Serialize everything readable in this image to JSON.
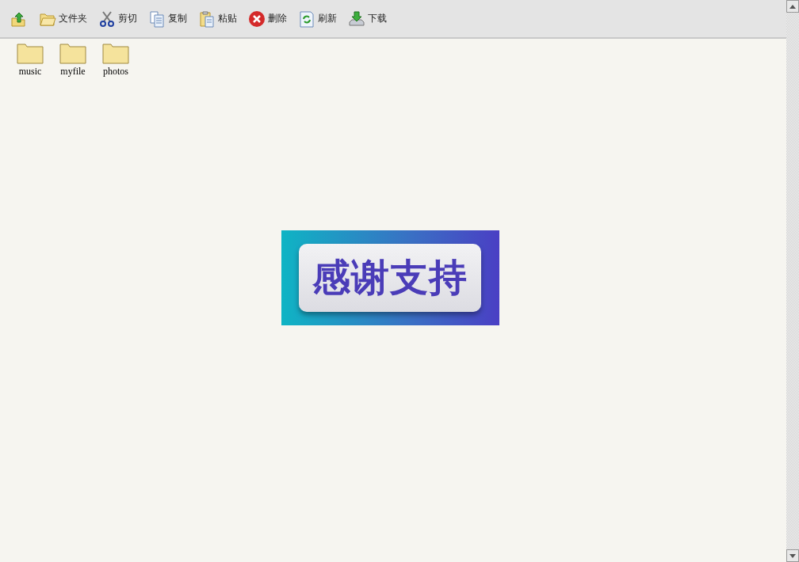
{
  "toolbar": {
    "buttons": [
      {
        "kind": "up"
      },
      {
        "kind": "folder",
        "label": "文件夹"
      },
      {
        "kind": "cut",
        "label": "剪切"
      },
      {
        "kind": "copy",
        "label": "复制"
      },
      {
        "kind": "paste",
        "label": "粘贴"
      },
      {
        "kind": "delete",
        "label": "删除"
      },
      {
        "kind": "refresh",
        "label": "刷新"
      },
      {
        "kind": "download",
        "label": "下载"
      }
    ]
  },
  "folders": [
    {
      "name": "music"
    },
    {
      "name": "myfile"
    },
    {
      "name": "photos"
    }
  ],
  "banner": {
    "text": "感谢支持"
  }
}
